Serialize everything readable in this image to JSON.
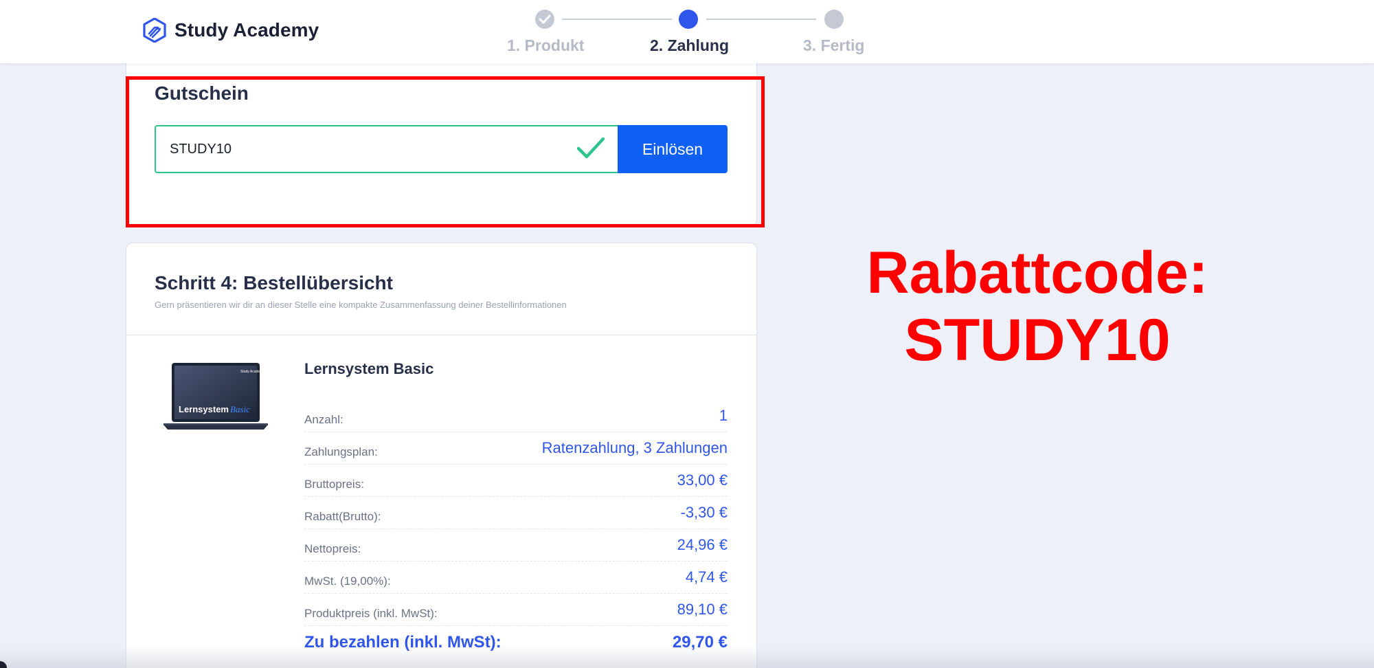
{
  "header": {
    "brand": "Study Academy",
    "steps": [
      {
        "label": "1. Produkt",
        "state": "done"
      },
      {
        "label": "2. Zahlung",
        "state": "active"
      },
      {
        "label": "3. Fertig",
        "state": "todo"
      }
    ]
  },
  "coupon": {
    "title": "Gutschein",
    "value": "STUDY10",
    "button_label": "Einlösen",
    "status_icon": "checkmark-icon"
  },
  "summary": {
    "title": "Schritt 4: Bestellübersicht",
    "subtitle": "Gern präsentieren wir dir an dieser Stelle eine kompakte Zusammenfassung deiner Bestellinformationen",
    "product": {
      "name": "Lernsystem Basic",
      "image_caption": "Lernsystem",
      "image_caption_script": "Basic",
      "image_brand": "Study Academy"
    },
    "rows": [
      {
        "label": "Anzahl:",
        "value": "1"
      },
      {
        "label": "Zahlungsplan:",
        "value": "Ratenzahlung, 3 Zahlungen"
      },
      {
        "label": "Bruttopreis:",
        "value": "33,00 €"
      },
      {
        "label": "Rabatt(Brutto):",
        "value": "-3,30 €"
      },
      {
        "label": "Nettopreis:",
        "value": "24,96 €"
      },
      {
        "label": "MwSt. (19,00%):",
        "value": "4,74 €"
      },
      {
        "label": "Produktpreis (inkl. MwSt):",
        "value": "89,10 €"
      }
    ],
    "total": {
      "label": "Zu bezahlen (inkl. MwSt):",
      "value": "29,70 €"
    }
  },
  "promo": {
    "line1": "Rabattcode:",
    "line2": "STUDY10"
  },
  "colors": {
    "accent": "#2f55ea",
    "button": "#0e5ff2",
    "success": "#2bc48a",
    "highlight": "#ff0000",
    "background": "#edf0f9"
  }
}
